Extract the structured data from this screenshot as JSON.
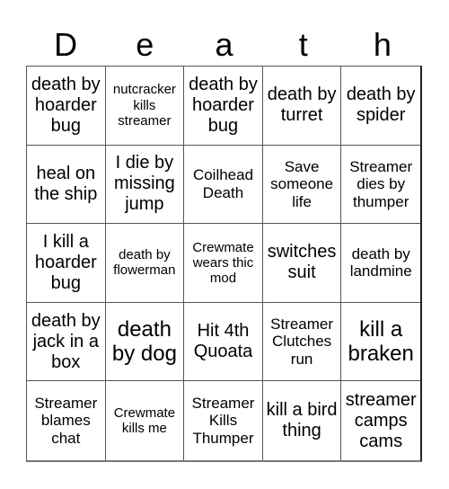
{
  "title": [
    "D",
    "e",
    "a",
    "t",
    "h"
  ],
  "board": [
    [
      "death by hoarder bug",
      "nutcracker kills streamer",
      "death by hoarder bug",
      "death by turret",
      "death by spider"
    ],
    [
      "heal on the ship",
      "I die by missing jump",
      "Coilhead Death",
      "Save someone life",
      "Streamer dies by thumper"
    ],
    [
      "I kill a hoarder bug",
      "death by flowerman",
      "Crewmate wears thic mod",
      "switches suit",
      "death by landmine"
    ],
    [
      "death by jack in a box",
      "death by dog",
      "Hit 4th Quoata",
      "Streamer Clutches run",
      "kill a braken"
    ],
    [
      "Streamer blames chat",
      "Crewmate kills me",
      "Streamer Kills Thumper",
      "kill a bird thing",
      "streamer camps cams"
    ]
  ]
}
